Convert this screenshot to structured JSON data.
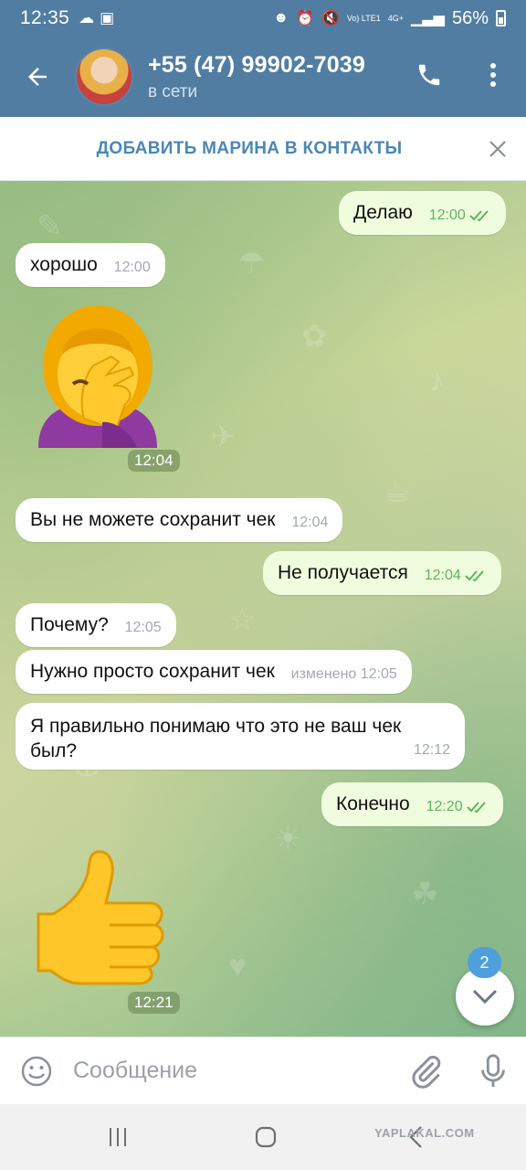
{
  "status_bar": {
    "time": "12:35",
    "network_label": "Vo) LTE1",
    "network_type": "4G+",
    "battery_percent": "56%"
  },
  "header": {
    "contact_title": "+55 (47) 99902-7039",
    "contact_status": "в сети"
  },
  "add_contact_bar": {
    "label": "ДОБАВИТЬ МАРИНА В КОНТАКТЫ"
  },
  "messages": [
    {
      "direction": "out",
      "text": "Делаю",
      "time": "12:00",
      "read": true
    },
    {
      "direction": "in",
      "text": "хорошо",
      "time": "12:00"
    },
    {
      "direction": "in",
      "sticker": "woman-facepalming",
      "time": "12:04"
    },
    {
      "direction": "in",
      "text": "Вы не можете сохранит чек",
      "time": "12:04"
    },
    {
      "direction": "out",
      "text": "Не получается",
      "time": "12:04",
      "read": true
    },
    {
      "direction": "in",
      "text": "Почему?",
      "time": "12:05"
    },
    {
      "direction": "in",
      "text": "Нужно просто сохранит чек",
      "time": "изменено 12:05"
    },
    {
      "direction": "in",
      "text": "Я правильно понимаю что это не ваш чек был?",
      "time": "12:12"
    },
    {
      "direction": "out",
      "text": "Конечно",
      "time": "12:20",
      "read": true
    },
    {
      "direction": "in",
      "sticker": "thumbs-up",
      "time": "12:21"
    }
  ],
  "scroll_down": {
    "unread_count": "2"
  },
  "composer": {
    "placeholder": "Сообщение"
  },
  "watermark": "YAPLAKAL.COM",
  "colors": {
    "header": "#517da2",
    "accent": "#4a87b6",
    "outgoing_bubble": "#effdde",
    "read_check": "#5fb35b",
    "badge": "#4f9fdc"
  }
}
